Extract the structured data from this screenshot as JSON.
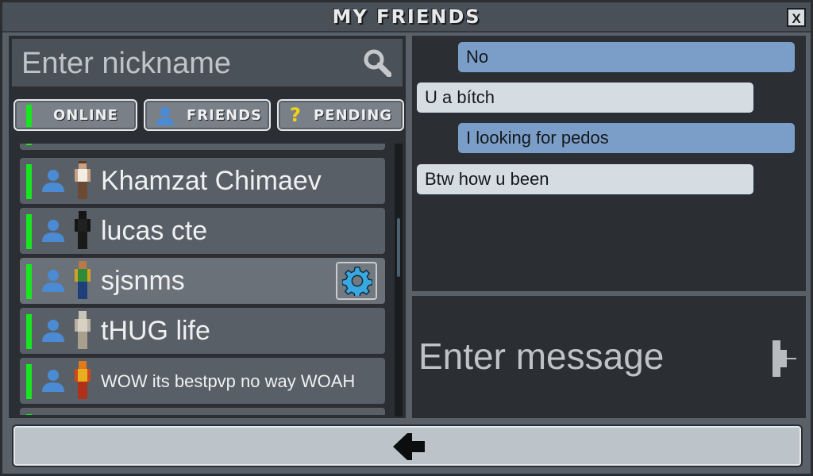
{
  "window": {
    "title": "MY FRIENDS",
    "close_label": "X"
  },
  "search": {
    "placeholder": "Enter nickname",
    "icon": "search-icon"
  },
  "tabs": [
    {
      "label": "ONLINE",
      "icon": "status-green-bar"
    },
    {
      "label": "FRIENDS",
      "icon": "person-icon"
    },
    {
      "label": "PENDING",
      "icon": "question-mark-icon"
    }
  ],
  "friends": [
    {
      "name": "Khamzat Chimaev",
      "status": "online"
    },
    {
      "name": "lucas cte",
      "status": "online"
    },
    {
      "name": "sjsnms",
      "status": "online",
      "selected": true,
      "settings_icon": "gear-icon"
    },
    {
      "name": "tHUG life",
      "status": "online"
    },
    {
      "name": "WOW its bestpvp no way WOAH",
      "status": "online"
    }
  ],
  "messages": [
    {
      "from": "me",
      "text": "No"
    },
    {
      "from": "friend",
      "text": "U a bítch"
    },
    {
      "from": "me",
      "text": "I looking for pedos"
    },
    {
      "from": "friend",
      "text": "Btw how u been"
    }
  ],
  "composer": {
    "placeholder": "Enter message",
    "send_icon": "send-icon"
  },
  "back": {
    "icon": "arrow-left-icon"
  },
  "colors": {
    "online": "#18e620",
    "my_bubble": "#7b9ec8",
    "friend_bubble": "#d5dde3",
    "panel": "#2b2f34",
    "row": "#595f66"
  }
}
